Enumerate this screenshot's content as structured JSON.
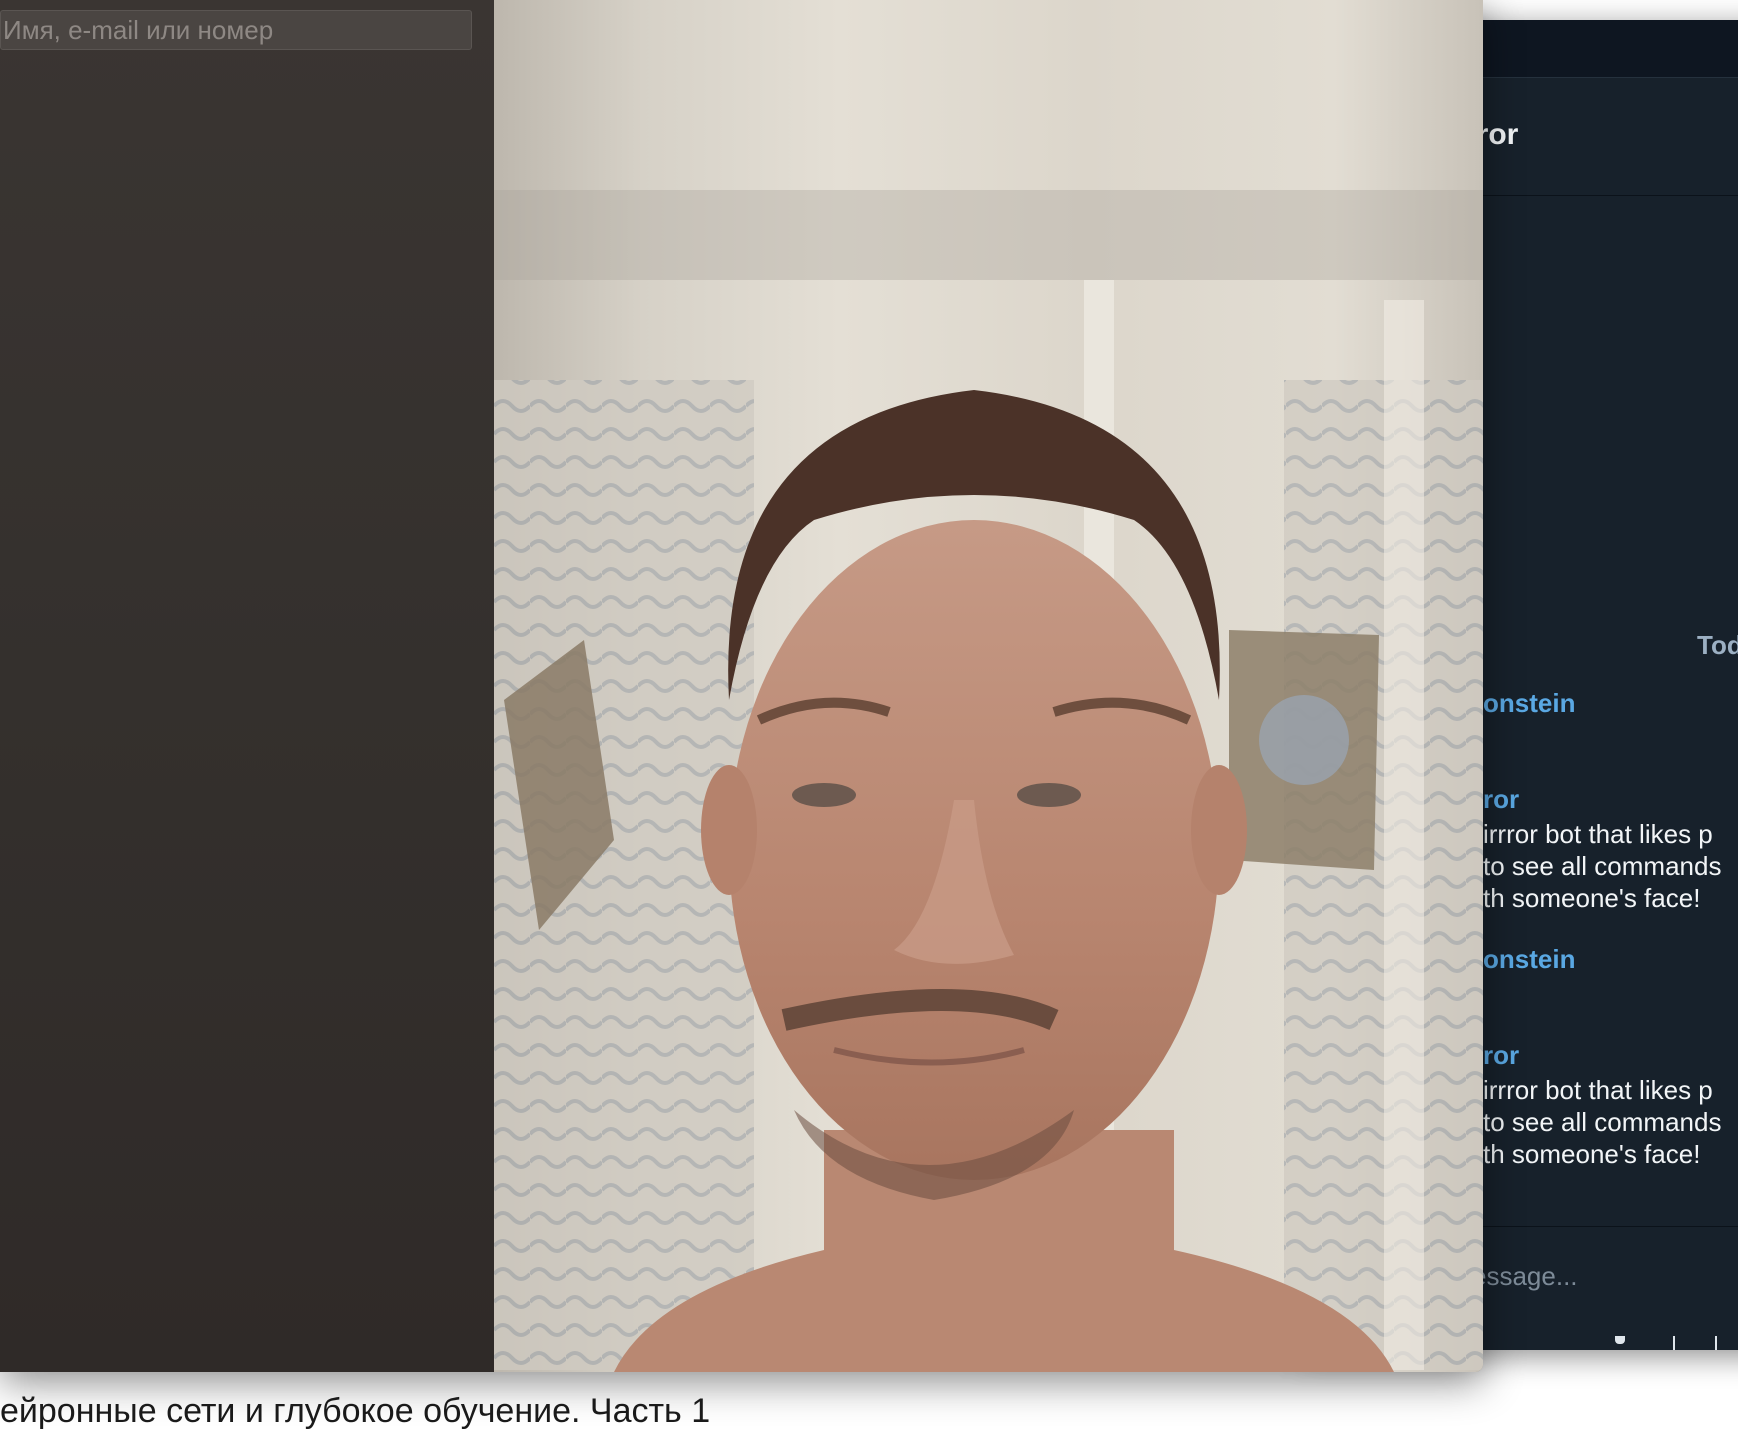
{
  "call": {
    "search_placeholder": "Имя, e-mail или номер"
  },
  "chat": {
    "title": "rror",
    "date_separator": "Tod",
    "messages": [
      {
        "author": "onstein"
      },
      {
        "author": "ror",
        "lines": [
          "irrror bot that likes p",
          "to see all commands",
          "th someone's face!"
        ]
      },
      {
        "author": "onstein"
      },
      {
        "author": "ror",
        "lines": [
          "irrror bot that likes p",
          "to see all commands",
          "th someone's face!"
        ]
      }
    ],
    "input_placeholder": "essage...",
    "colors": {
      "background": "#17212b",
      "author": "#5aa8e3",
      "text": "#f2f5f7"
    }
  },
  "page": {
    "caption": "ейронные сети и глубокое обучение. Часть 1"
  }
}
